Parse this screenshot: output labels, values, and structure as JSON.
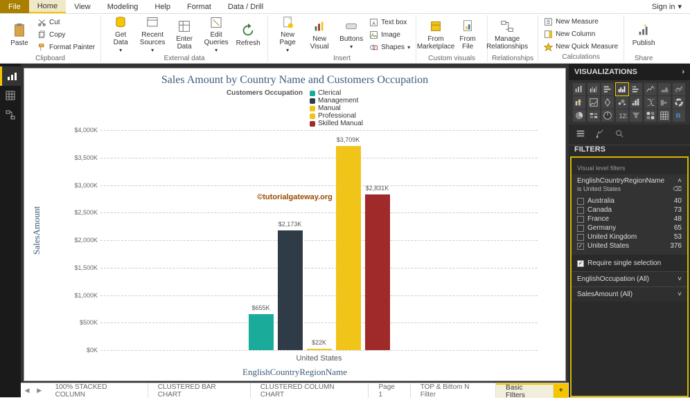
{
  "menu": {
    "file": "File",
    "home": "Home",
    "view": "View",
    "modeling": "Modeling",
    "help": "Help",
    "format": "Format",
    "datadrill": "Data / Drill"
  },
  "signin": "Sign in",
  "ribbon": {
    "clipboard": {
      "paste": "Paste",
      "cut": "Cut",
      "copy": "Copy",
      "fmtpainter": "Format Painter",
      "label": "Clipboard"
    },
    "external": {
      "getdata": "Get\nData",
      "recent": "Recent\nSources",
      "enter": "Enter\nData",
      "edit": "Edit\nQueries",
      "refresh": "Refresh",
      "label": "External data"
    },
    "insert": {
      "newpage": "New\nPage",
      "newvisual": "New\nVisual",
      "buttons": "Buttons",
      "textbox": "Text box",
      "image": "Image",
      "shapes": "Shapes",
      "label": "Insert"
    },
    "custom": {
      "marketplace": "From\nMarketplace",
      "file": "From\nFile",
      "label": "Custom visuals"
    },
    "rel": {
      "manage": "Manage\nRelationships",
      "label": "Relationships"
    },
    "calc": {
      "newmeasure": "New Measure",
      "newcolumn": "New Column",
      "newquick": "New Quick Measure",
      "label": "Calculations"
    },
    "share": {
      "publish": "Publish",
      "label": "Share"
    }
  },
  "chart_data": {
    "type": "bar",
    "title": "Sales Amount by Country Name and Customers Occupation",
    "legend_title": "Customers Occupation",
    "xlabel": "EnglishCountryRegionName",
    "ylabel": "SalesAmount",
    "ylim": [
      0,
      4000000
    ],
    "y_ticks": [
      "$0K",
      "$500K",
      "$1,000K",
      "$1,500K",
      "$2,000K",
      "$2,500K",
      "$3,000K",
      "$3,500K",
      "$4,000K"
    ],
    "categories": [
      "United States"
    ],
    "series": [
      {
        "name": "Clerical",
        "color": "#1aab9b",
        "values": [
          655000
        ],
        "labels": [
          "$655K"
        ]
      },
      {
        "name": "Management",
        "color": "#2f3b47",
        "values": [
          2173000
        ],
        "labels": [
          "$2,173K"
        ]
      },
      {
        "name": "Manual",
        "color": "#f0c419",
        "values": [
          22000
        ],
        "labels": [
          "$22K"
        ]
      },
      {
        "name": "Professional",
        "color": "#f0c419",
        "values": [
          3709000
        ],
        "labels": [
          "$3,709K"
        ]
      },
      {
        "name": "Skilled Manual",
        "color": "#a02a2a",
        "values": [
          2831000
        ],
        "labels": [
          "$2,831K"
        ]
      }
    ],
    "watermark": "©tutorialgateway.org"
  },
  "page_tabs": [
    "100% STACKED COLUMN",
    "CLUSTERED BAR CHART",
    "CLUSTERED COLUMN CHART",
    "Page 1",
    "TOP & Bittom N Filter",
    "Basic FIlters"
  ],
  "right": {
    "viz_header": "VISUALIZATIONS",
    "filters_header": "FILTERS",
    "visual_filters_label": "Visual level filters",
    "region_filter": {
      "field": "EnglishCountryRegionName",
      "summary": "is United States",
      "options": [
        {
          "label": "Australia",
          "count": 40,
          "checked": false
        },
        {
          "label": "Canada",
          "count": 73,
          "checked": false
        },
        {
          "label": "France",
          "count": 48,
          "checked": false
        },
        {
          "label": "Germany",
          "count": 65,
          "checked": false
        },
        {
          "label": "United Kingdom",
          "count": 53,
          "checked": false
        },
        {
          "label": "United States",
          "count": 376,
          "checked": true
        }
      ]
    },
    "require_single": "Require single selection",
    "occ_filter": "EnglishOccupation (All)",
    "sales_filter": "SalesAmount (All)"
  }
}
